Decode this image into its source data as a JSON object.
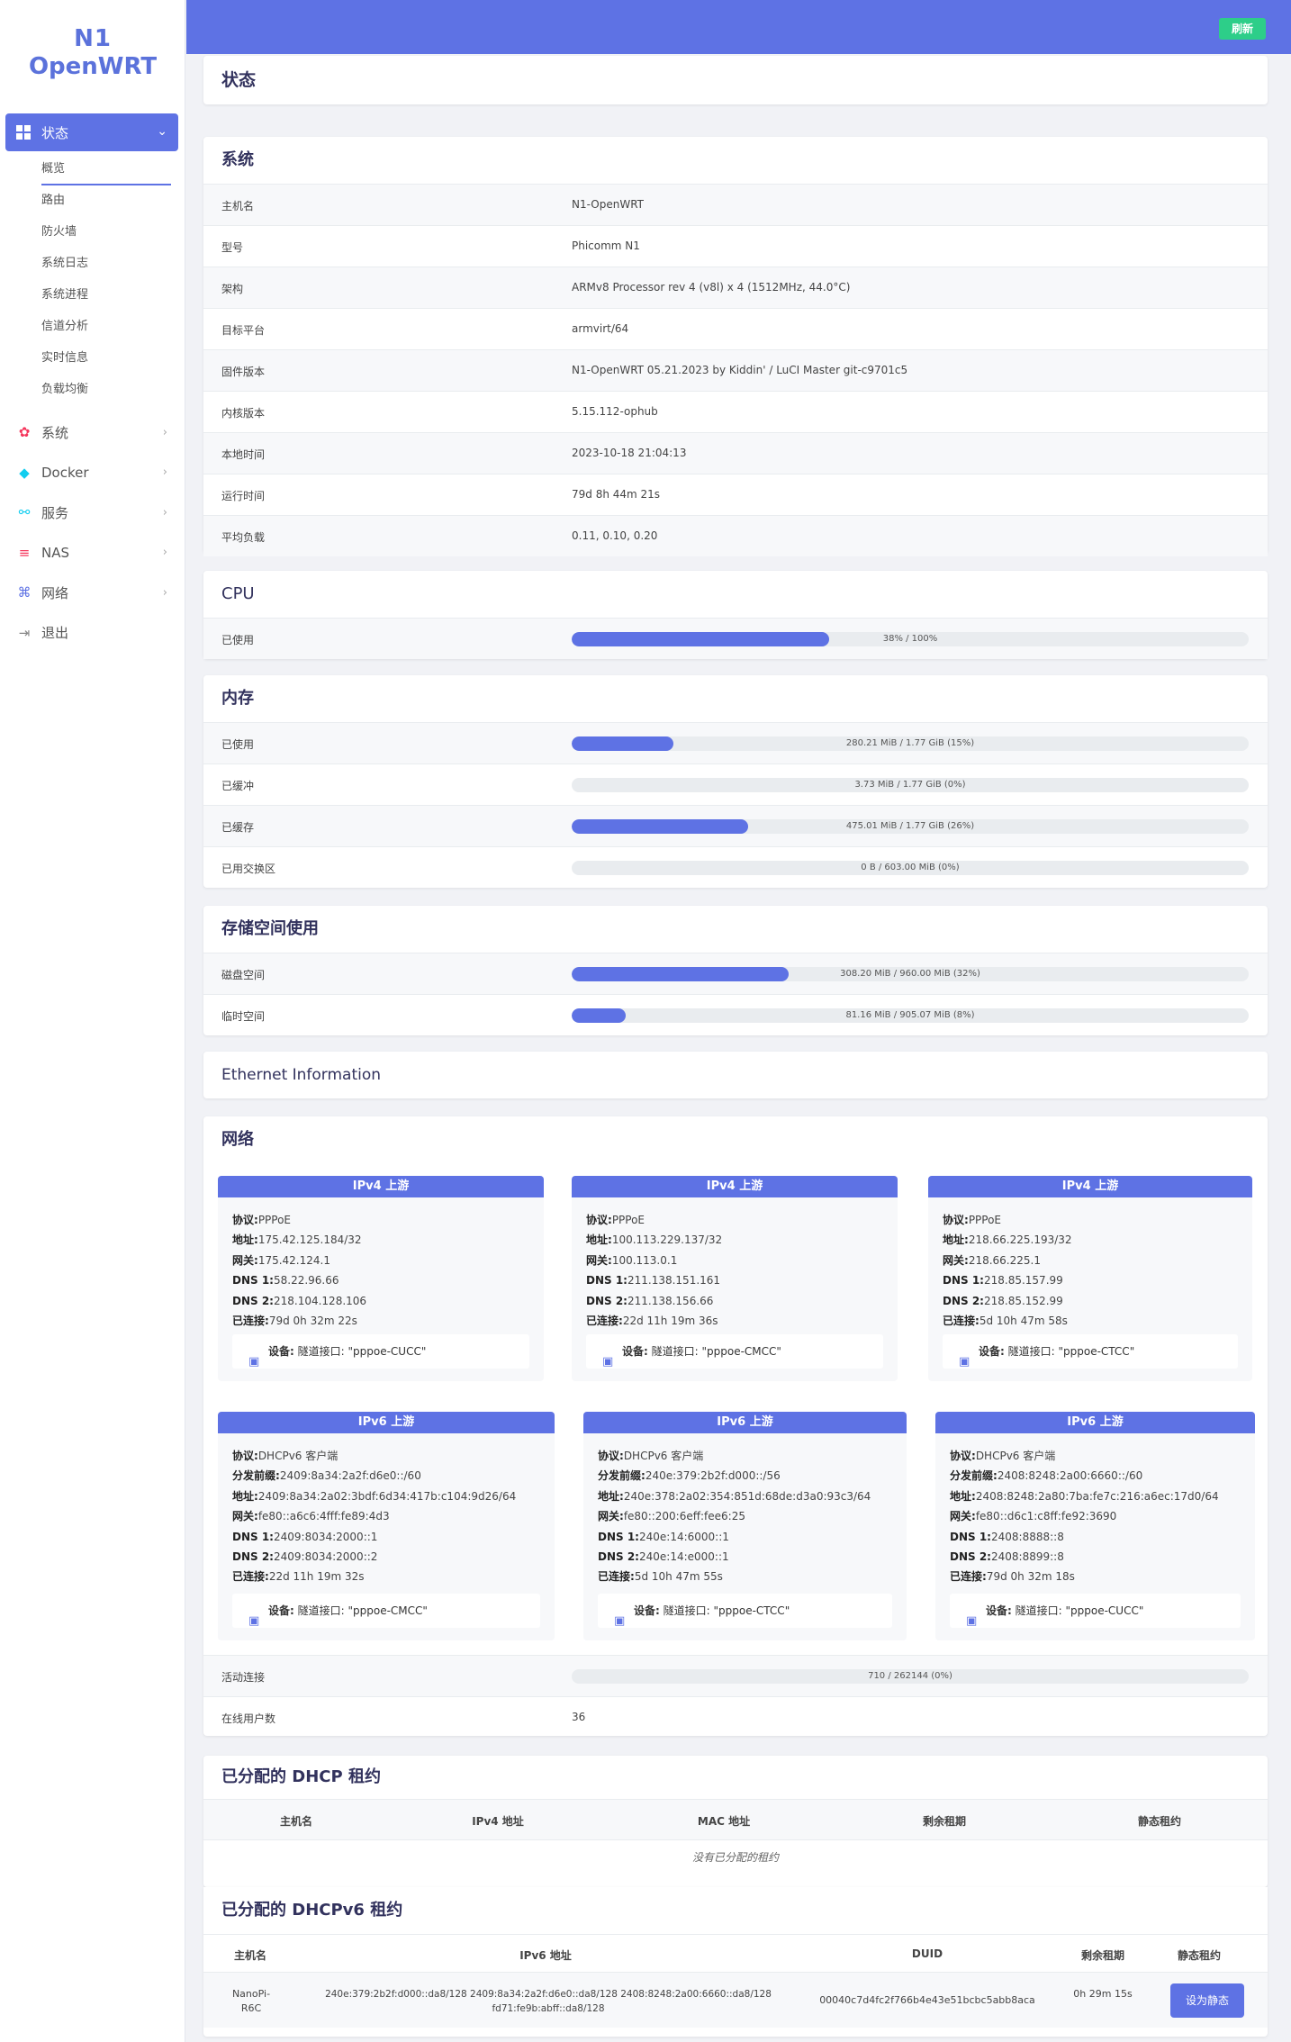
{
  "sidebar": {
    "logo_line1": "N1",
    "logo_line2": "OpenWRT",
    "active": "状态",
    "sub_items": [
      "概览",
      "路由",
      "防火墙",
      "系统日志",
      "系统进程",
      "信道分析",
      "实时信息",
      "负载均衡"
    ],
    "items": [
      {
        "label": "系统",
        "icon": "gear-icon"
      },
      {
        "label": "Docker",
        "icon": "docker-icon"
      },
      {
        "label": "服务",
        "icon": "services-icon"
      },
      {
        "label": "NAS",
        "icon": "database-icon"
      },
      {
        "label": "网络",
        "icon": "network-icon"
      },
      {
        "label": "退出",
        "icon": "logout-icon"
      }
    ]
  },
  "header": {
    "refresh_label": "刷新",
    "page_title": "状态"
  },
  "system": {
    "title": "系统",
    "rows": [
      {
        "k": "主机名",
        "v": "N1-OpenWRT"
      },
      {
        "k": "型号",
        "v": "Phicomm N1"
      },
      {
        "k": "架构",
        "v": "ARMv8 Processor rev 4 (v8l) x 4 (1512MHz, 44.0°C)"
      },
      {
        "k": "目标平台",
        "v": "armvirt/64"
      },
      {
        "k": "固件版本",
        "v": "N1-OpenWRT 05.21.2023 by Kiddin' / LuCI Master git-c9701c5"
      },
      {
        "k": "内核版本",
        "v": "5.15.112-ophub"
      },
      {
        "k": "本地时间",
        "v": "2023-10-18 21:04:13"
      },
      {
        "k": "运行时间",
        "v": "79d 8h 44m 21s"
      },
      {
        "k": "平均负载",
        "v": "0.11, 0.10, 0.20"
      }
    ]
  },
  "cpu": {
    "title": "CPU",
    "rows": [
      {
        "k": "已使用",
        "text": "38% / 100%",
        "pct": 38
      }
    ]
  },
  "memory": {
    "title": "内存",
    "rows": [
      {
        "k": "已使用",
        "text": "280.21 MiB / 1.77 GiB (15%)",
        "pct": 15
      },
      {
        "k": "已缓冲",
        "text": "3.73 MiB / 1.77 GiB (0%)",
        "pct": 0
      },
      {
        "k": "已缓存",
        "text": "475.01 MiB / 1.77 GiB (26%)",
        "pct": 26
      },
      {
        "k": "已用交换区",
        "text": "0 B / 603.00 MiB (0%)",
        "pct": 0
      }
    ]
  },
  "storage": {
    "title": "存储空间使用",
    "rows": [
      {
        "k": "磁盘空间",
        "text": "308.20 MiB / 960.00 MiB (32%)",
        "pct": 32
      },
      {
        "k": "临时空间",
        "text": "81.16 MiB / 905.07 MiB (8%)",
        "pct": 8
      }
    ]
  },
  "ethernet": {
    "title": "Ethernet Information"
  },
  "network": {
    "title": "网络",
    "ipv4_title": "IPv4 上游",
    "ipv6_title": "IPv6 上游",
    "ipv4": [
      {
        "lines": [
          [
            "协议:",
            "PPPoE"
          ],
          [
            "地址:",
            "175.42.125.184/32"
          ],
          [
            "网关:",
            "175.42.124.1"
          ],
          [
            "DNS 1:",
            "58.22.96.66"
          ],
          [
            "DNS 2:",
            "218.104.128.106"
          ],
          [
            "已连接:",
            "79d 0h 32m 22s"
          ]
        ],
        "dev_label": "设备:",
        "dev": "隧道接口: \"pppoe-CUCC\""
      },
      {
        "lines": [
          [
            "协议:",
            "PPPoE"
          ],
          [
            "地址:",
            "100.113.229.137/32"
          ],
          [
            "网关:",
            "100.113.0.1"
          ],
          [
            "DNS 1:",
            "211.138.151.161"
          ],
          [
            "DNS 2:",
            "211.138.156.66"
          ],
          [
            "已连接:",
            "22d 11h 19m 36s"
          ]
        ],
        "dev_label": "设备:",
        "dev": "隧道接口: \"pppoe-CMCC\""
      },
      {
        "lines": [
          [
            "协议:",
            "PPPoE"
          ],
          [
            "地址:",
            "218.66.225.193/32"
          ],
          [
            "网关:",
            "218.66.225.1"
          ],
          [
            "DNS 1:",
            "218.85.157.99"
          ],
          [
            "DNS 2:",
            "218.85.152.99"
          ],
          [
            "已连接:",
            "5d 10h 47m 58s"
          ]
        ],
        "dev_label": "设备:",
        "dev": "隧道接口: \"pppoe-CTCC\""
      }
    ],
    "ipv6": [
      {
        "lines": [
          [
            "协议:",
            "DHCPv6 客户端"
          ],
          [
            "分发前缀:",
            "2409:8a34:2a2f:d6e0::/60"
          ],
          [
            "地址:",
            "2409:8a34:2a02:3bdf:6d34:417b:c104:9d26/64"
          ],
          [
            "网关:",
            "fe80::a6c6:4fff:fe89:4d3"
          ],
          [
            "DNS 1:",
            "2409:8034:2000::1"
          ],
          [
            "DNS 2:",
            "2409:8034:2000::2"
          ],
          [
            "已连接:",
            "22d 11h 19m 32s"
          ]
        ],
        "dev_label": "设备:",
        "dev": "隧道接口: \"pppoe-CMCC\""
      },
      {
        "lines": [
          [
            "协议:",
            "DHCPv6 客户端"
          ],
          [
            "分发前缀:",
            "240e:379:2b2f:d000::/56"
          ],
          [
            "地址:",
            "240e:378:2a02:354:851d:68de:d3a0:93c3/64"
          ],
          [
            "网关:",
            "fe80::200:6eff:fee6:25"
          ],
          [
            "DNS 1:",
            "240e:14:6000::1"
          ],
          [
            "DNS 2:",
            "240e:14:e000::1"
          ],
          [
            "已连接:",
            "5d 10h 47m 55s"
          ]
        ],
        "dev_label": "设备:",
        "dev": "隧道接口: \"pppoe-CTCC\""
      },
      {
        "lines": [
          [
            "协议:",
            "DHCPv6 客户端"
          ],
          [
            "分发前缀:",
            "2408:8248:2a00:6660::/60"
          ],
          [
            "地址:",
            "2408:8248:2a80:7ba:fe7c:216:a6ec:17d0/64"
          ],
          [
            "网关:",
            "fe80::d6c1:c8ff:fe92:3690"
          ],
          [
            "DNS 1:",
            "2408:8888::8"
          ],
          [
            "DNS 2:",
            "2408:8899::8"
          ],
          [
            "已连接:",
            "79d 0h 32m 18s"
          ]
        ],
        "dev_label": "设备:",
        "dev": "隧道接口: \"pppoe-CUCC\""
      }
    ],
    "active_conn": {
      "k": "活动连接",
      "text": "710 / 262144 (0%)",
      "pct": 0
    },
    "online_users": {
      "k": "在线用户数",
      "v": "36"
    }
  },
  "dhcp": {
    "title": "已分配的 DHCP 租约",
    "headers": [
      "主机名",
      "IPv4 地址",
      "MAC 地址",
      "剩余租期",
      "静态租约"
    ],
    "empty": "没有已分配的租约"
  },
  "dhcpv6": {
    "title": "已分配的 DHCPv6 租约",
    "headers": [
      "主机名",
      "IPv6 地址",
      "DUID",
      "剩余租期",
      "静态租约"
    ],
    "rows": [
      {
        "host": "NanoPi-R6C",
        "ipv6": "240e:379:2b2f:d000::da8/128 2409:8a34:2a2f:d6e0::da8/128 2408:8248:2a00:6660::da8/128 fd71:fe9b:abff::da8/128",
        "duid": "00040c7d4fc2f766b4e43e51bcbc5abb8aca",
        "lease": "0h 29m 15s",
        "action": "设为静态"
      }
    ]
  }
}
